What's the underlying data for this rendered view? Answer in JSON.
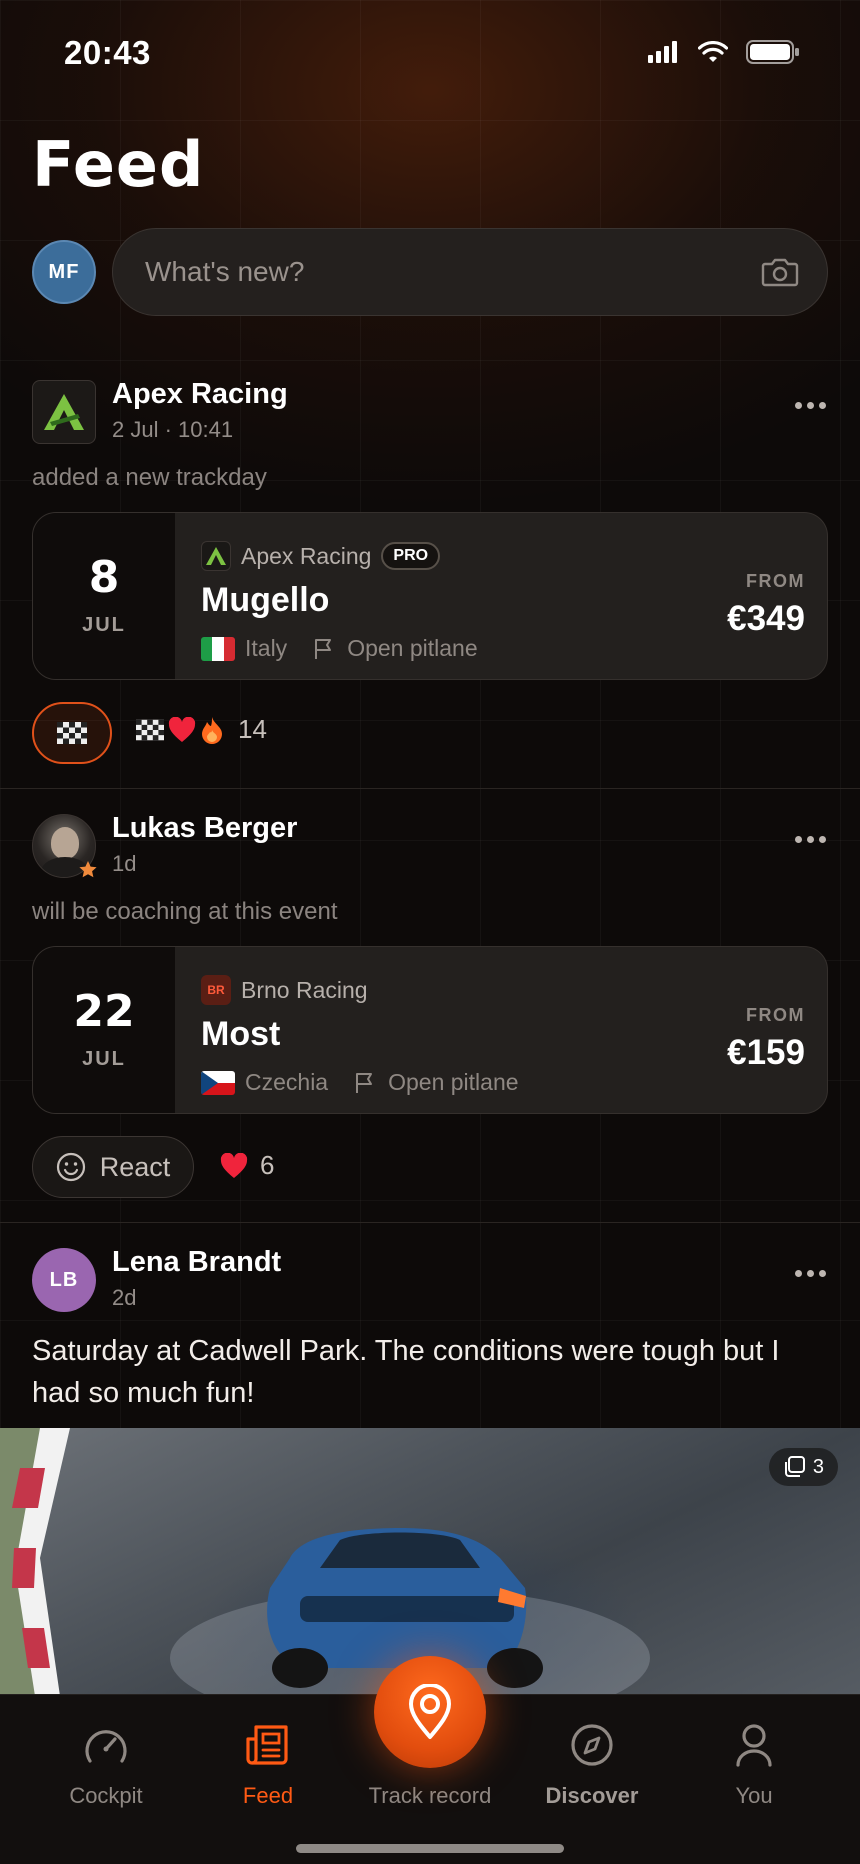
{
  "status_bar": {
    "time": "20:43"
  },
  "header": {
    "title": "Feed"
  },
  "composer": {
    "avatar_initials": "MF",
    "placeholder": "What's new?"
  },
  "posts": [
    {
      "author": "Apex Racing",
      "meta": "2 Jul · 10:41",
      "action": "added a new trackday",
      "event": {
        "day": "8",
        "month": "JUL",
        "organizer": "Apex Racing",
        "badge": "PRO",
        "track": "Mugello",
        "country": "Italy",
        "format": "Open pitlane",
        "from_label": "FROM",
        "price": "€349"
      },
      "reactions": {
        "count": "14"
      }
    },
    {
      "author": "Lukas Berger",
      "meta": "1d",
      "action": "will be coaching at this event",
      "event": {
        "day": "22",
        "month": "JUL",
        "organizer": "Brno Racing",
        "organizer_logo": "BR",
        "track": "Most",
        "country": "Czechia",
        "format": "Open pitlane",
        "from_label": "FROM",
        "price": "€159"
      },
      "react_label": "React",
      "reactions": {
        "count": "6"
      }
    },
    {
      "author": "Lena Brandt",
      "avatar_initials": "LB",
      "meta": "2d",
      "text": "Saturday at Cadwell Park. The conditions were tough but I had so much fun!",
      "photo_count": "3"
    }
  ],
  "tabbar": {
    "items": [
      {
        "label": "Cockpit",
        "icon": "gauge-icon"
      },
      {
        "label": "Feed",
        "icon": "newspaper-icon",
        "active": true
      },
      {
        "label": "Track record",
        "icon": "location-pin-icon"
      },
      {
        "label": "Discover",
        "icon": "compass-icon"
      },
      {
        "label": "You",
        "icon": "person-icon"
      }
    ]
  },
  "colors": {
    "accent": "#ff5a14",
    "background": "#0d0a09",
    "card": "#23201e"
  }
}
